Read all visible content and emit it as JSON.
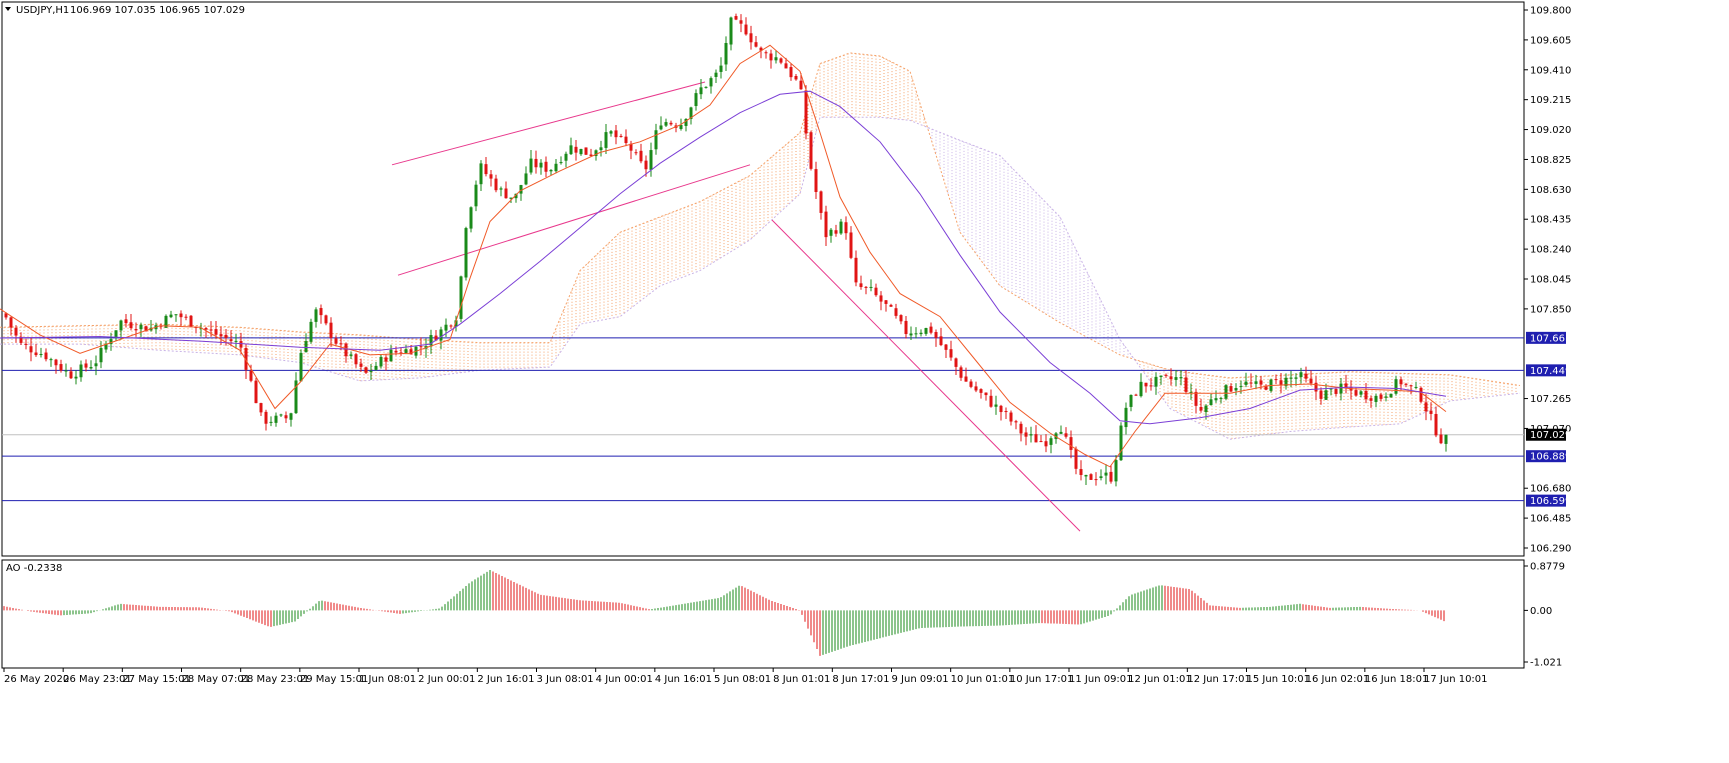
{
  "header": {
    "symbol": "USDJPY,H1",
    "ohlc": "106.969 107.035 106.965 107.029",
    "ao_label": "AO -0.2338"
  },
  "colors": {
    "bull": "#1a8a1a",
    "bear": "#e01414",
    "ma_fast": "#f05a28",
    "ma_slow": "#7b3fd6",
    "cloud_a": "#f5a36b",
    "cloud_b": "#c9b3e6",
    "level": "#1f1fb0",
    "channel": "#e8388c",
    "grid": "#c8c8c8"
  },
  "chart_data": [
    {
      "type": "candlestick",
      "symbol": "USDJPY",
      "timeframe": "H1",
      "last": {
        "open": 106.969,
        "high": 107.035,
        "low": 106.965,
        "close": 107.029
      },
      "ylim": [
        106.29,
        109.8
      ],
      "y_ticks": [
        "109.800",
        "109.605",
        "109.410",
        "109.215",
        "109.020",
        "108.825",
        "108.630",
        "108.435",
        "108.240",
        "108.045",
        "107.850",
        "107.265",
        "107.070",
        "106.680",
        "106.485",
        "106.290"
      ],
      "x_ticks": [
        "26 May 2020",
        "26 May 23:01",
        "27 May 15:01",
        "28 May 07:01",
        "28 May 23:01",
        "29 May 15:01",
        "1 Jun 08:01",
        "2 Jun 00:01",
        "2 Jun 16:01",
        "3 Jun 08:01",
        "4 Jun 00:01",
        "4 Jun 16:01",
        "5 Jun 08:01",
        "8 Jun 01:01",
        "8 Jun 17:01",
        "9 Jun 09:01",
        "10 Jun 01:01",
        "10 Jun 17:01",
        "11 Jun 09:01",
        "12 Jun 01:01",
        "12 Jun 17:01",
        "15 Jun 10:01",
        "16 Jun 02:01",
        "16 Jun 18:01",
        "17 Jun 10:01"
      ],
      "close_path": [
        [
          0,
          107.87
        ],
        [
          20,
          107.62
        ],
        [
          45,
          107.55
        ],
        [
          70,
          107.42
        ],
        [
          95,
          107.5
        ],
        [
          120,
          107.77
        ],
        [
          150,
          107.72
        ],
        [
          175,
          107.82
        ],
        [
          210,
          107.7
        ],
        [
          240,
          107.62
        ],
        [
          262,
          107.12
        ],
        [
          290,
          107.14
        ],
        [
          300,
          107.55
        ],
        [
          315,
          107.84
        ],
        [
          340,
          107.6
        ],
        [
          365,
          107.42
        ],
        [
          390,
          107.56
        ],
        [
          420,
          107.6
        ],
        [
          440,
          107.7
        ],
        [
          458,
          107.82
        ],
        [
          465,
          108.38
        ],
        [
          480,
          108.78
        ],
        [
          500,
          108.62
        ],
        [
          515,
          108.57
        ],
        [
          530,
          108.8
        ],
        [
          550,
          108.76
        ],
        [
          570,
          108.91
        ],
        [
          590,
          108.86
        ],
        [
          610,
          109.0
        ],
        [
          630,
          108.9
        ],
        [
          645,
          108.75
        ],
        [
          660,
          109.08
        ],
        [
          680,
          109.05
        ],
        [
          700,
          109.28
        ],
        [
          720,
          109.4
        ],
        [
          730,
          109.72
        ],
        [
          745,
          109.68
        ],
        [
          760,
          109.52
        ],
        [
          780,
          109.48
        ],
        [
          800,
          109.3
        ],
        [
          810,
          108.8
        ],
        [
          825,
          108.33
        ],
        [
          845,
          108.41
        ],
        [
          855,
          108.0
        ],
        [
          870,
          107.97
        ],
        [
          890,
          107.84
        ],
        [
          905,
          107.7
        ],
        [
          930,
          107.72
        ],
        [
          950,
          107.53
        ],
        [
          965,
          107.38
        ],
        [
          985,
          107.27
        ],
        [
          1005,
          107.16
        ],
        [
          1025,
          107.02
        ],
        [
          1045,
          106.98
        ],
        [
          1060,
          107.1
        ],
        [
          1080,
          106.73
        ],
        [
          1100,
          106.77
        ],
        [
          1112,
          106.75
        ],
        [
          1125,
          107.2
        ],
        [
          1140,
          107.35
        ],
        [
          1160,
          107.38
        ],
        [
          1180,
          107.4
        ],
        [
          1200,
          107.18
        ],
        [
          1215,
          107.28
        ],
        [
          1240,
          107.37
        ],
        [
          1260,
          107.34
        ],
        [
          1280,
          107.38
        ],
        [
          1300,
          107.41
        ],
        [
          1320,
          107.29
        ],
        [
          1340,
          107.33
        ],
        [
          1360,
          107.3
        ],
        [
          1380,
          107.27
        ],
        [
          1400,
          107.38
        ],
        [
          1420,
          107.29
        ],
        [
          1440,
          107.0
        ],
        [
          1448,
          107.03
        ]
      ],
      "ma_fast_path": [
        [
          0,
          107.85
        ],
        [
          40,
          107.68
        ],
        [
          80,
          107.56
        ],
        [
          120,
          107.65
        ],
        [
          160,
          107.74
        ],
        [
          200,
          107.73
        ],
        [
          240,
          107.58
        ],
        [
          275,
          107.2
        ],
        [
          300,
          107.37
        ],
        [
          330,
          107.62
        ],
        [
          370,
          107.55
        ],
        [
          410,
          107.56
        ],
        [
          450,
          107.65
        ],
        [
          470,
          108.05
        ],
        [
          490,
          108.42
        ],
        [
          520,
          108.62
        ],
        [
          560,
          108.75
        ],
        [
          600,
          108.87
        ],
        [
          640,
          108.94
        ],
        [
          680,
          109.05
        ],
        [
          710,
          109.18
        ],
        [
          740,
          109.45
        ],
        [
          770,
          109.57
        ],
        [
          800,
          109.4
        ],
        [
          820,
          109.0
        ],
        [
          840,
          108.58
        ],
        [
          870,
          108.22
        ],
        [
          900,
          107.95
        ],
        [
          940,
          107.8
        ],
        [
          975,
          107.52
        ],
        [
          1010,
          107.24
        ],
        [
          1050,
          107.04
        ],
        [
          1085,
          106.9
        ],
        [
          1110,
          106.82
        ],
        [
          1135,
          107.05
        ],
        [
          1165,
          107.3
        ],
        [
          1200,
          107.3
        ],
        [
          1230,
          107.3
        ],
        [
          1270,
          107.35
        ],
        [
          1310,
          107.36
        ],
        [
          1350,
          107.33
        ],
        [
          1390,
          107.32
        ],
        [
          1420,
          107.31
        ],
        [
          1446,
          107.18
        ]
      ],
      "ma_slow_path": [
        [
          0,
          107.66
        ],
        [
          100,
          107.67
        ],
        [
          200,
          107.64
        ],
        [
          300,
          107.6
        ],
        [
          380,
          107.58
        ],
        [
          430,
          107.62
        ],
        [
          460,
          107.75
        ],
        [
          500,
          107.95
        ],
        [
          540,
          108.16
        ],
        [
          580,
          108.38
        ],
        [
          620,
          108.6
        ],
        [
          660,
          108.8
        ],
        [
          700,
          108.97
        ],
        [
          740,
          109.13
        ],
        [
          780,
          109.25
        ],
        [
          810,
          109.27
        ],
        [
          840,
          109.17
        ],
        [
          880,
          108.94
        ],
        [
          920,
          108.6
        ],
        [
          960,
          108.2
        ],
        [
          1000,
          107.83
        ],
        [
          1050,
          107.5
        ],
        [
          1090,
          107.3
        ],
        [
          1120,
          107.12
        ],
        [
          1150,
          107.1
        ],
        [
          1200,
          107.14
        ],
        [
          1250,
          107.2
        ],
        [
          1300,
          107.32
        ],
        [
          1350,
          107.34
        ],
        [
          1400,
          107.33
        ],
        [
          1446,
          107.28
        ]
      ],
      "horizontal_levels": [
        "107.661",
        "107.449",
        "106.889",
        "106.599"
      ],
      "current_price": "107.029",
      "channel_lines": [
        {
          "from": [
            392,
            108.79
          ],
          "to": [
            705,
            109.33
          ]
        },
        {
          "from": [
            398,
            108.07
          ],
          "to": [
            750,
            108.79
          ]
        },
        {
          "from": [
            772,
            108.43
          ],
          "to": [
            1080,
            106.4
          ]
        }
      ],
      "cloud_a": [
        [
          0,
          107.73
        ],
        [
          80,
          107.74
        ],
        [
          160,
          107.75
        ],
        [
          240,
          107.73
        ],
        [
          300,
          107.7
        ],
        [
          360,
          107.68
        ],
        [
          420,
          107.65
        ],
        [
          480,
          107.63
        ],
        [
          550,
          107.63
        ],
        [
          580,
          108.1
        ],
        [
          620,
          108.35
        ],
        [
          660,
          108.45
        ],
        [
          700,
          108.55
        ],
        [
          750,
          108.72
        ],
        [
          800,
          109.0
        ],
        [
          820,
          109.45
        ],
        [
          850,
          109.52
        ],
        [
          880,
          109.5
        ],
        [
          910,
          109.4
        ],
        [
          960,
          108.35
        ],
        [
          1000,
          108.0
        ],
        [
          1060,
          107.76
        ],
        [
          1120,
          107.55
        ],
        [
          1170,
          107.45
        ],
        [
          1230,
          107.4
        ],
        [
          1290,
          107.42
        ],
        [
          1350,
          107.44
        ],
        [
          1400,
          107.43
        ],
        [
          1450,
          107.42
        ],
        [
          1520,
          107.35
        ]
      ],
      "cloud_b": [
        [
          0,
          107.62
        ],
        [
          80,
          107.62
        ],
        [
          160,
          107.58
        ],
        [
          240,
          107.55
        ],
        [
          300,
          107.5
        ],
        [
          360,
          107.38
        ],
        [
          420,
          107.4
        ],
        [
          480,
          107.45
        ],
        [
          550,
          107.47
        ],
        [
          580,
          107.75
        ],
        [
          620,
          107.8
        ],
        [
          660,
          108.0
        ],
        [
          700,
          108.1
        ],
        [
          750,
          108.3
        ],
        [
          800,
          108.6
        ],
        [
          820,
          109.1
        ],
        [
          850,
          109.1
        ],
        [
          880,
          109.1
        ],
        [
          910,
          109.08
        ],
        [
          960,
          108.95
        ],
        [
          1000,
          108.85
        ],
        [
          1060,
          108.45
        ],
        [
          1120,
          107.65
        ],
        [
          1170,
          107.2
        ],
        [
          1230,
          107.0
        ],
        [
          1290,
          107.05
        ],
        [
          1350,
          107.08
        ],
        [
          1400,
          107.1
        ],
        [
          1450,
          107.25
        ],
        [
          1520,
          107.3
        ]
      ]
    },
    {
      "type": "bar",
      "name": "AO",
      "current": "-0.2338",
      "ylim": [
        -1.021,
        0.8779
      ],
      "y_ticks": [
        "0.8779",
        "0.00",
        "-1.021"
      ],
      "path": [
        [
          0,
          0.1
        ],
        [
          30,
          -0.02
        ],
        [
          60,
          -0.1
        ],
        [
          90,
          -0.06
        ],
        [
          120,
          0.13
        ],
        [
          160,
          0.07
        ],
        [
          200,
          0.06
        ],
        [
          230,
          -0.02
        ],
        [
          270,
          -0.33
        ],
        [
          295,
          -0.22
        ],
        [
          320,
          0.2
        ],
        [
          360,
          0.05
        ],
        [
          400,
          -0.07
        ],
        [
          440,
          0.04
        ],
        [
          470,
          0.55
        ],
        [
          490,
          0.8
        ],
        [
          510,
          0.6
        ],
        [
          540,
          0.31
        ],
        [
          580,
          0.2
        ],
        [
          620,
          0.15
        ],
        [
          650,
          0.02
        ],
        [
          690,
          0.15
        ],
        [
          720,
          0.25
        ],
        [
          740,
          0.5
        ],
        [
          770,
          0.2
        ],
        [
          800,
          0.0
        ],
        [
          820,
          -0.9
        ],
        [
          850,
          -0.7
        ],
        [
          880,
          -0.55
        ],
        [
          920,
          -0.35
        ],
        [
          960,
          -0.32
        ],
        [
          1000,
          -0.3
        ],
        [
          1040,
          -0.25
        ],
        [
          1080,
          -0.28
        ],
        [
          1110,
          -0.1
        ],
        [
          1130,
          0.3
        ],
        [
          1160,
          0.5
        ],
        [
          1190,
          0.42
        ],
        [
          1210,
          0.1
        ],
        [
          1240,
          0.05
        ],
        [
          1270,
          0.07
        ],
        [
          1300,
          0.13
        ],
        [
          1330,
          0.05
        ],
        [
          1360,
          0.07
        ],
        [
          1390,
          0.03
        ],
        [
          1420,
          0.0
        ],
        [
          1446,
          -0.23
        ]
      ]
    }
  ]
}
